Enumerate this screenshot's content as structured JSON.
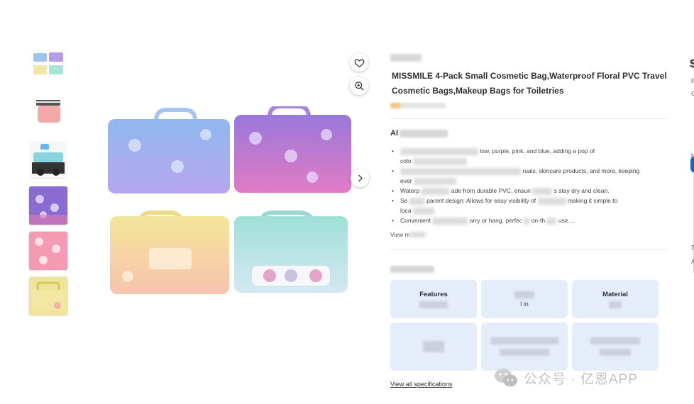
{
  "product": {
    "title": "MISSMILE 4-Pack Small Cosmetic Bag,Waterproof Floral PVC Travel Cosmetic Bags,Makeup Bags for Toiletries"
  },
  "about": {
    "label_visible": "Al",
    "bullets": [
      {
        "visible_a": "colo",
        "visible_b": "low, purple, pink, and blue, adding a pop of",
        "visible_c": ""
      },
      {
        "visible_a": "",
        "visible_b": "ruals, skincare products, and more, keeping",
        "visible_c": "ever"
      },
      {
        "visible_a": "Waterp",
        "visible_b": "ade from durable PVC, ensuri",
        "visible_c": "s stay dry and clean."
      },
      {
        "visible_a": "Se",
        "visible_b": "parent design: Allows for easy visibility of",
        "visible_c": "making it simple to"
      },
      {
        "visible_a": "Convenient",
        "visible_b": "arry or hang, perfec",
        "visible_c": "on-th"
      }
    ],
    "bullet_tails": [
      "",
      "",
      "",
      "loca",
      "use...."
    ],
    "view_more": "View m"
  },
  "specs": {
    "cards": [
      {
        "key": "Features",
        "value": ""
      },
      {
        "key": "",
        "value": "l in"
      },
      {
        "key": "Material",
        "value": ""
      },
      {
        "key": "",
        "value": ""
      },
      {
        "key": "",
        "value": ""
      },
      {
        "key": "",
        "value": ""
      }
    ],
    "view_all": "View all specifications"
  },
  "right_col": {
    "price_glyph": "$",
    "letters": [
      "P",
      "C",
      "H",
      "S",
      "A"
    ]
  },
  "watermark": {
    "text": "公众号 · 亿恩APP"
  },
  "icons": {
    "wishlist": "heart-icon",
    "zoom": "zoom-in-icon",
    "next": "chevron-right-icon"
  },
  "colors": {
    "spec_card_bg": "#e6edfa",
    "accent_blue": "#0071dc"
  }
}
